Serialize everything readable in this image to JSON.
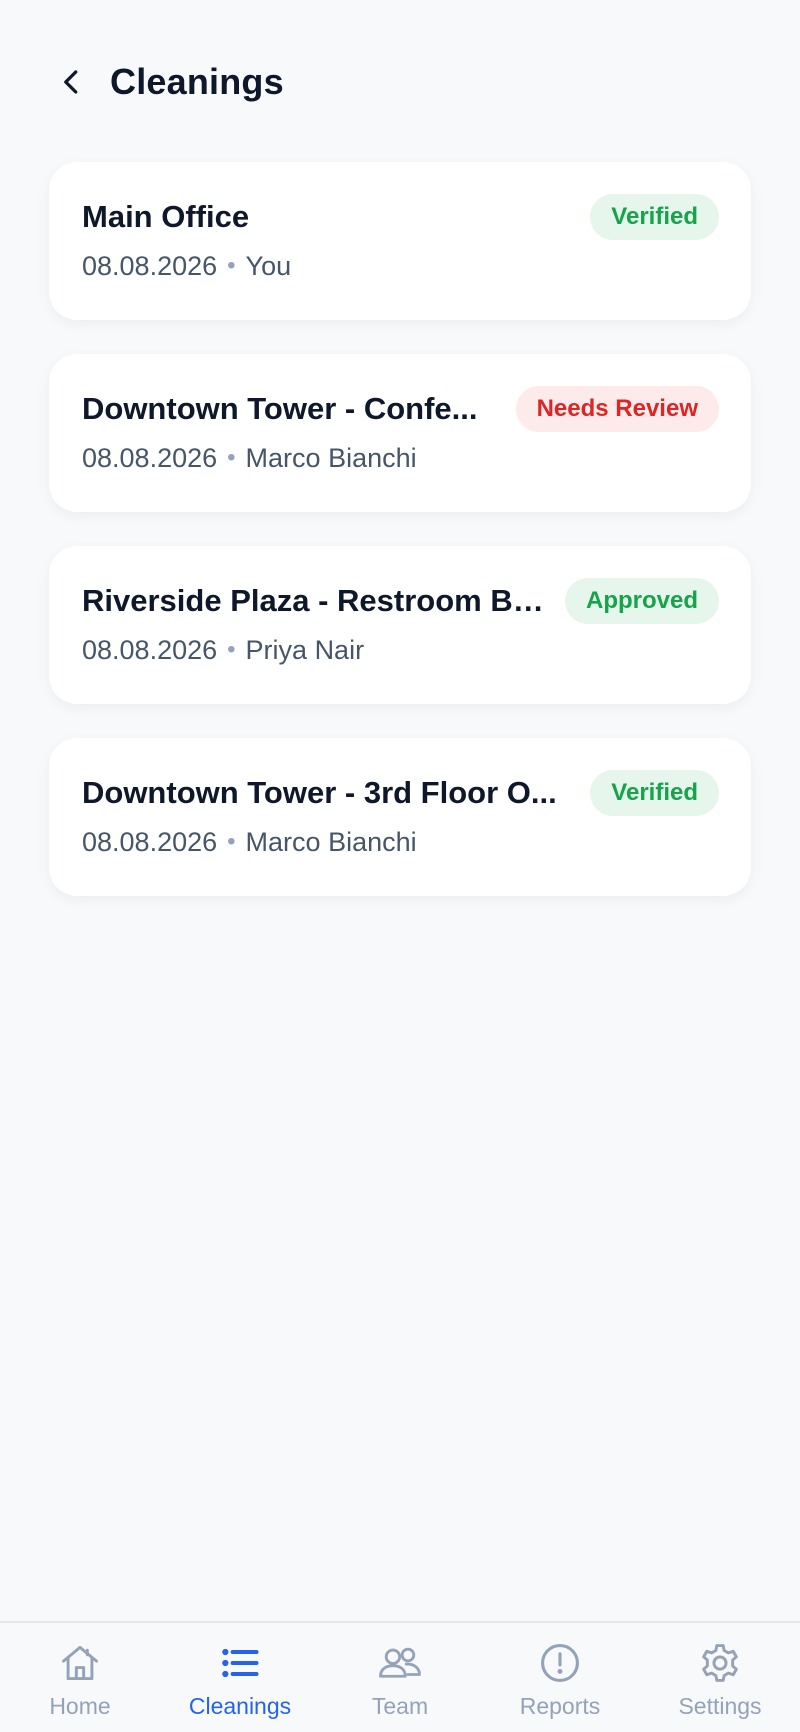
{
  "header": {
    "title": "Cleanings",
    "back_icon": "chevron-left-icon"
  },
  "cleanings": [
    {
      "title": "Main Office",
      "date": "08.08.2026",
      "person": "You",
      "status": "Verified",
      "status_color": "#16a34a"
    },
    {
      "title": "Downtown Tower - Confe...",
      "date": "08.08.2026",
      "person": "Marco Bianchi",
      "status": "Needs Review",
      "status_color": "#dc2626"
    },
    {
      "title": "Riverside Plaza - Restroom Bl...",
      "date": "08.08.2026",
      "person": "Priya Nair",
      "status": "Approved",
      "status_color": "#16a34a"
    },
    {
      "title": "Downtown Tower - 3rd Floor O...",
      "date": "08.08.2026",
      "person": "Marco Bianchi",
      "status": "Verified",
      "status_color": "#16a34a"
    }
  ],
  "separator": "•",
  "nav": {
    "items": [
      {
        "label": "Home",
        "icon": "home-icon"
      },
      {
        "label": "Cleanings",
        "icon": "list-icon",
        "active": true
      },
      {
        "label": "Team",
        "icon": "users-icon"
      },
      {
        "label": "Reports",
        "icon": "alert-circle-icon"
      },
      {
        "label": "Settings",
        "icon": "gear-icon"
      }
    ],
    "active_color": "#2563eb",
    "inactive_color": "#94a3b8"
  }
}
